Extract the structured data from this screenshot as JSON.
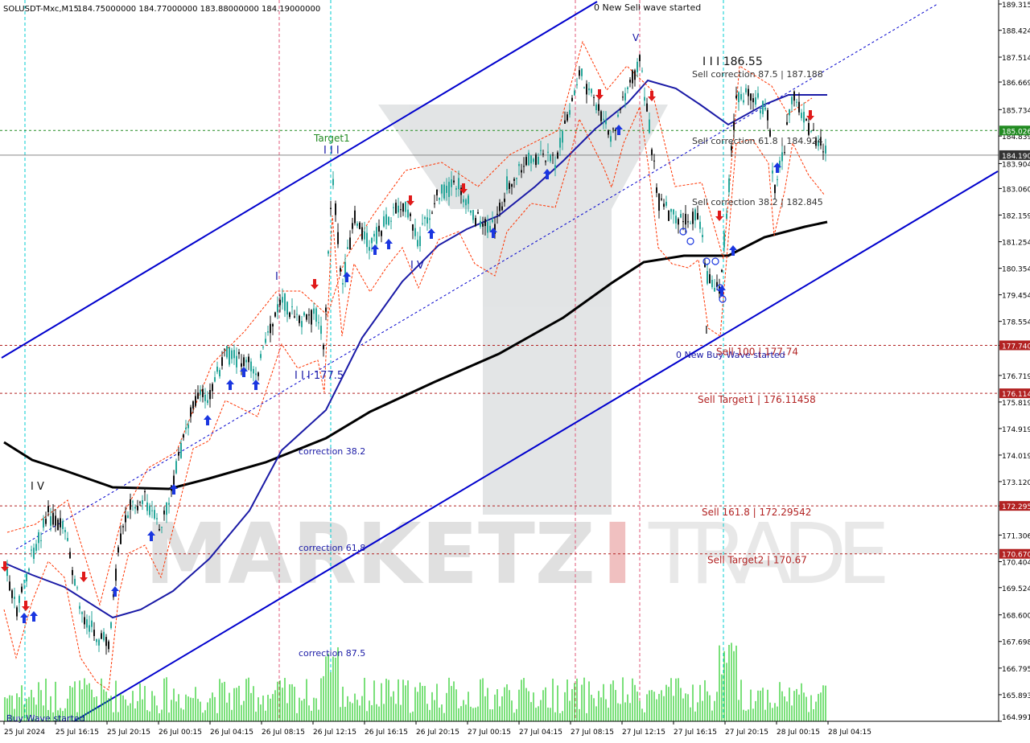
{
  "header": {
    "symbol": "SOLUSDT-Mxc,M15",
    "ohlc": "184.75000000 184.77000000 183.88000000 184.19000000"
  },
  "watermark": {
    "left": "MARKETZ",
    "accent": "I",
    "right": "TRADE"
  },
  "colors": {
    "bull": "#26a69a",
    "bear": "#111111",
    "fast_ma": "#1a1aa6",
    "slow_ma": "#000000",
    "channel": "#0000cd",
    "level": "#b22222",
    "target": "#228b22",
    "current": "#333333",
    "session": "#00ced1",
    "day": "#e05a7a",
    "volume": "#22cc22",
    "sl": "#ff3300"
  },
  "chart_data": {
    "type": "candlestick",
    "symbol": "SOLUSDT",
    "timeframe": "M15",
    "ylim": [
      164.991,
      189.315
    ],
    "ticks_y": [
      "189.315",
      "188.424",
      "187.514",
      "186.669",
      "185.734",
      "184.839",
      "183.904",
      "183.060",
      "182.159",
      "181.254",
      "180.354",
      "179.454",
      "178.554",
      "177.740",
      "176.719",
      "175.819",
      "174.919",
      "174.019",
      "173.120",
      "172.295",
      "171.306",
      "170.404",
      "169.524",
      "168.600",
      "167.698",
      "166.795",
      "165.893",
      "164.991"
    ],
    "ticks_x": [
      "25 Jul 2024",
      "25 Jul 16:15",
      "25 Jul 20:15",
      "26 Jul 00:15",
      "26 Jul 04:15",
      "26 Jul 08:15",
      "26 Jul 12:15",
      "26 Jul 16:15",
      "26 Jul 20:15",
      "27 Jul 00:15",
      "27 Jul 04:15",
      "27 Jul 08:15",
      "27 Jul 12:15",
      "27 Jul 16:15",
      "27 Jul 20:15",
      "28 Jul 00:15",
      "28 Jul 04:15"
    ],
    "current_price": "184.190",
    "price_tags": [
      {
        "value": 185.026,
        "label": "185.026",
        "color": "#228b22"
      },
      {
        "value": 177.74,
        "label": "177.740",
        "color": "#b22222"
      },
      {
        "value": 176.114,
        "label": "176.114",
        "color": "#b22222"
      },
      {
        "value": 172.295,
        "label": "172.295",
        "color": "#b22222"
      },
      {
        "value": 170.67,
        "label": "170.670",
        "color": "#b22222"
      }
    ],
    "levels": [
      {
        "value": 177.74,
        "label": "Sell 100 | 177.74"
      },
      {
        "value": 176.11458,
        "label": "Sell Target1 | 176.11458"
      },
      {
        "value": 172.29542,
        "label": "Sell 161.8 | 172.29542"
      },
      {
        "value": 170.67,
        "label": "Sell Target2 | 170.67"
      }
    ],
    "annotations": [
      {
        "text": "0 New Sell wave started",
        "x": 738,
        "y": 13,
        "color": "#111111",
        "size": 11
      },
      {
        "text": "V",
        "x": 786,
        "y": 51,
        "color": "#1a1aa6",
        "size": 12
      },
      {
        "text": "I I I 186.55",
        "x": 873,
        "y": 81,
        "color": "#111111",
        "size": 14
      },
      {
        "text": "Sell correction 87.5 | 187.188",
        "x": 860,
        "y": 96,
        "color": "#333333",
        "size": 11
      },
      {
        "text": "Sell correction 61.8 | 184.924",
        "x": 860,
        "y": 179,
        "color": "#333333",
        "size": 11
      },
      {
        "text": "Sell correction 38.2 | 182.845",
        "x": 860,
        "y": 255,
        "color": "#333333",
        "size": 11
      },
      {
        "text": "Target1",
        "x": 390,
        "y": 176,
        "color": "#228b22",
        "size": 12
      },
      {
        "text": "I I I",
        "x": 402,
        "y": 191,
        "color": "#1a1aa6",
        "size": 13
      },
      {
        "text": "I V",
        "x": 510,
        "y": 334,
        "color": "#1a1aa6",
        "size": 13
      },
      {
        "text": "I",
        "x": 342,
        "y": 348,
        "color": "#1a1aa6",
        "size": 13
      },
      {
        "text": "I I I 177.5",
        "x": 366,
        "y": 471,
        "color": "#1a1aa6",
        "size": 13
      },
      {
        "text": "I V",
        "x": 38,
        "y": 609,
        "color": "#111111",
        "size": 13
      },
      {
        "text": "correction 38.2",
        "x": 371,
        "y": 565,
        "color": "#1a1aa6",
        "size": 11
      },
      {
        "text": "correction 61.8",
        "x": 371,
        "y": 685,
        "color": "#1a1aa6",
        "size": 11
      },
      {
        "text": "correction 87.5",
        "x": 371,
        "y": 816,
        "color": "#1a1aa6",
        "size": 11
      },
      {
        "text": "0 New Buy Wave started",
        "x": 840,
        "y": 445,
        "color": "#1a1aa6",
        "size": 11
      },
      {
        "text": "I",
        "x": 876,
        "y": 415,
        "color": "#111111",
        "size": 13
      },
      {
        "text": "Buy Wave started",
        "x": 8,
        "y": 897,
        "color": "#1a1aa6",
        "size": 11
      }
    ]
  }
}
